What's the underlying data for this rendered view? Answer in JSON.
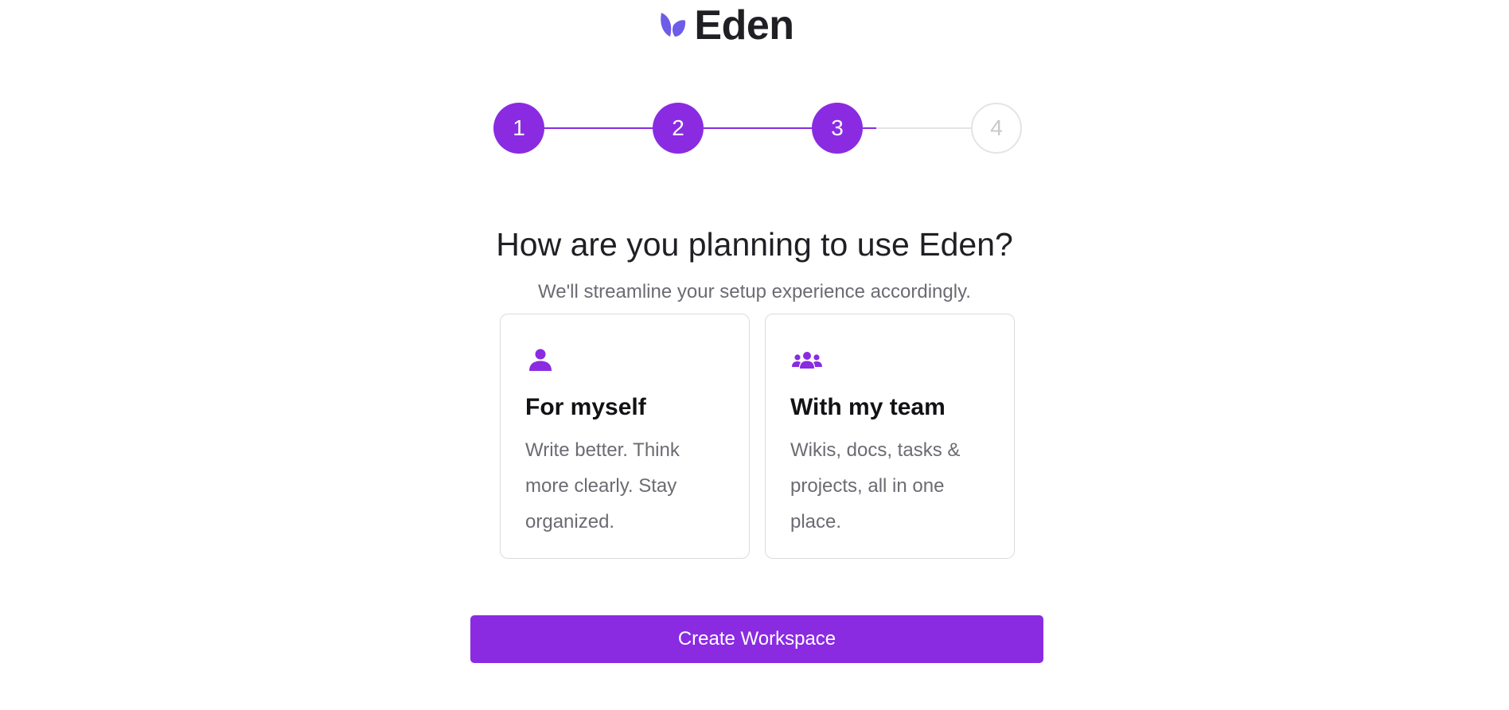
{
  "logo": {
    "text": "Eden",
    "icon": "leaf-logo-icon",
    "color": "#6c5ce7"
  },
  "stepper": {
    "steps": [
      {
        "label": "1",
        "state": "complete"
      },
      {
        "label": "2",
        "state": "complete"
      },
      {
        "label": "3",
        "state": "current"
      },
      {
        "label": "4",
        "state": "pending"
      }
    ],
    "accent": "#8a2be2"
  },
  "heading": "How are you planning to use Eden?",
  "subheading": "We'll streamline your setup experience accordingly.",
  "options": [
    {
      "icon": "user-icon",
      "title": "For myself",
      "description": "Write better. Think more clearly. Stay organized."
    },
    {
      "icon": "team-icon",
      "title": "With my team",
      "description": "Wikis, docs, tasks & projects, all in one place."
    }
  ],
  "button": {
    "label": "Create Workspace",
    "color": "#8a2be2"
  }
}
